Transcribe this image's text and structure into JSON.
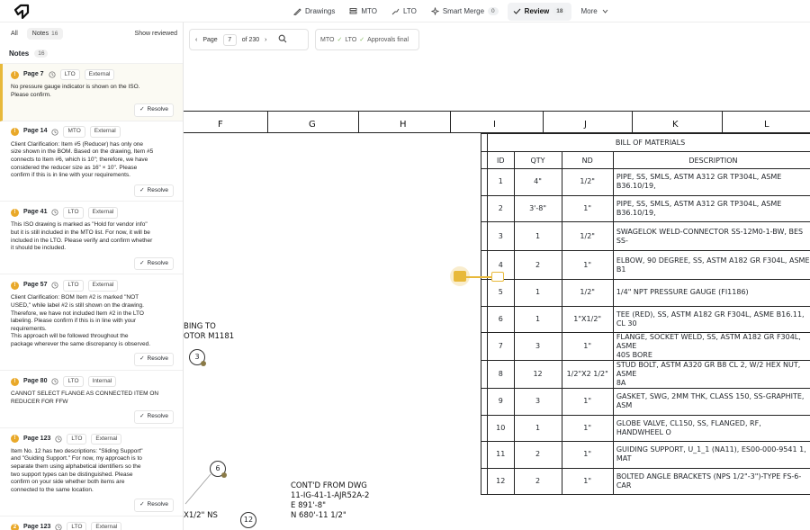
{
  "nav": {
    "items": [
      {
        "label": "Drawings",
        "icon": "pencil-icon",
        "badge": null,
        "active": false
      },
      {
        "label": "MTO",
        "icon": "stack-icon",
        "badge": null,
        "active": false
      },
      {
        "label": "LTO",
        "icon": "pipe-icon",
        "badge": null,
        "active": false
      },
      {
        "label": "Smart Merge",
        "icon": "sparkle-icon",
        "badge": "0",
        "active": false
      },
      {
        "label": "Review",
        "icon": "check-icon",
        "badge": "18",
        "active": true
      },
      {
        "label": "More",
        "icon": "chevron-down-icon",
        "badge": null,
        "active": false
      }
    ]
  },
  "filters": {
    "all_label": "All",
    "notes_label": "Notes",
    "notes_count": "16",
    "show_reviewed_label": "Show reviewed"
  },
  "notes_header": {
    "title": "Notes",
    "count": "16"
  },
  "notes": [
    {
      "num": "!",
      "page": "Page 7",
      "stage": "LTO",
      "scope": "External",
      "text": "No pressure gauge indicator is shown on the ISO.\nPlease confirm.",
      "resolve": "Resolve",
      "selected": true
    },
    {
      "num": "!",
      "page": "Page 14",
      "stage": "MTO",
      "scope": "External",
      "text": "Client Clarification: Item #5 (Reducer) has only one\nsize shown in the BOM. Based on the drawing, Item #5\nconnects to Item #6, which is 10\"; therefore, we have\nconsidered the reducer size as 16\" × 10\". Please\nconfirm if this is in line with your requirements.",
      "resolve": "Resolve",
      "selected": false
    },
    {
      "num": "!",
      "page": "Page 41",
      "stage": "LTO",
      "scope": "External",
      "text": "This ISO drawing is marked as \"Hold for vendor info\"\nbut it is still included in the MTO list. For now, it will be\nincluded in the LTO. Please verify and confirm whether\nit should be included.",
      "resolve": "Resolve",
      "selected": false
    },
    {
      "num": "!",
      "page": "Page 57",
      "stage": "LTO",
      "scope": "External",
      "text": "Client Clarification: BOM Item #2 is marked \"NOT\nUSED,\" while label #2 is still shown on the drawing.\nTherefore, we have not included Item #2 in the LTO\nlabeling. Please confirm if this is in line with your\nrequirements.\nThis approach will be followed throughout the\npackage wherever the same discrepancy is observed.",
      "resolve": "Resolve",
      "selected": false
    },
    {
      "num": "!",
      "page": "Page 80",
      "stage": "LTO",
      "scope": "Internal",
      "text": "CANNOT SELECT FLANGE AS CONNECTED ITEM ON\nREDUCER FOR FFW",
      "resolve": "Resolve",
      "selected": false
    },
    {
      "num": "!",
      "page": "Page 123",
      "stage": "LTO",
      "scope": "External",
      "text": "Item No. 12 has two descriptions: \"Sliding Support\"\nand \"Guiding Support.\" For now, my approach is to\nseparate them using alphabetical identifiers so the\ntwo support types can be distinguished. Please\nconfirm on your side whether both items are\nconnected to the same location.",
      "resolve": "Resolve",
      "selected": false
    },
    {
      "num": "2",
      "page": "Page 123",
      "stage": "LTO",
      "scope": "External",
      "text": "",
      "resolve": "",
      "selected": false
    }
  ],
  "pager": {
    "label": "Page",
    "current": "7",
    "total": "of 230"
  },
  "status": {
    "steps": [
      "MTO",
      "LTO",
      "Approvals final"
    ]
  },
  "drawing": {
    "columns": [
      "F",
      "G",
      "H",
      "I",
      "J",
      "K",
      "L"
    ],
    "bom_title": "BILL OF MATERIALS",
    "bom_headers": [
      "ID",
      "QTY",
      "ND",
      "DESCRIPTION"
    ],
    "bom_rows": [
      [
        "1",
        "4\"",
        "1/2\"",
        "PIPE, SS, SMLS, ASTM A312 GR TP304L, ASME B36.10/19,"
      ],
      [
        "2",
        "3'-8\"",
        "1\"",
        "PIPE, SS, SMLS, ASTM A312 GR TP304L, ASME B36.10/19,"
      ],
      [
        "3",
        "1",
        "1/2\"",
        "SWAGELOK WELD-CONNECTOR SS-12M0-1-BW, BES SS-"
      ],
      [
        "4",
        "2",
        "1\"",
        "ELBOW, 90 DEGREE, SS, ASTM A182 GR F304L, ASME B1"
      ],
      [
        "5",
        "1",
        "1/2\"",
        "1/4\" NPT PRESSURE GAUGE (FI1186)"
      ],
      [
        "6",
        "1",
        "1\"X1/2\"",
        "TEE (RED), SS, ASTM A182 GR F304L, ASME B16.11, CL 30"
      ],
      [
        "7",
        "3",
        "1\"",
        "FLANGE, SOCKET WELD, SS, ASTM A182 GR F304L, ASME\n40S BORE"
      ],
      [
        "8",
        "12",
        "1/2\"X2 1/2\"",
        "STUD BOLT, ASTM A320 GR B8 CL 2, W/2 HEX NUT, ASME\n8A"
      ],
      [
        "9",
        "3",
        "1\"",
        "GASKET, SWG, 2MM THK, CLASS 150, SS-GRAPHITE, ASM"
      ],
      [
        "10",
        "1",
        "1\"",
        "GLOBE VALVE, CL150, SS, FLANGED, RF, HANDWHEEL O"
      ],
      [
        "11",
        "2",
        "1\"",
        "GUIDING SUPPORT, U_1_1 (NA11), ES00-000-9541 1, MAT"
      ],
      [
        "12",
        "2",
        "1\"",
        "BOLTED ANGLE BRACKETS (NPS 1/2\"-3\")-TYPE FS-6-CAR"
      ]
    ],
    "text_left": "BING TO\nOTOR M1181",
    "text_contd": "CONT'D FROM DWG\n11-IG-41-1-AJR52A-2\nE 891'-8\"\nN 680'-11 1/2\"",
    "text_ns": "X1/2\" NS",
    "bubbles": [
      "3",
      "6",
      "12"
    ]
  }
}
